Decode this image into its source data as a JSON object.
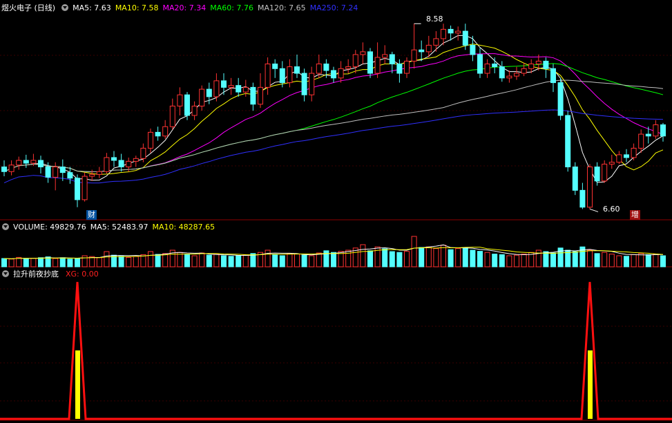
{
  "header": {
    "stock_title": "煜火电子 (日线)",
    "ma": [
      {
        "label": "MA5: 7.63",
        "color": "#ffffff"
      },
      {
        "label": "MA10: 7.58",
        "color": "#ffff00"
      },
      {
        "label": "MA20: 7.34",
        "color": "#ff00ff"
      },
      {
        "label": "MA60: 7.76",
        "color": "#00ff00"
      },
      {
        "label": "MA120: 7.65",
        "color": "#c0c0c0"
      },
      {
        "label": "MA250: 7.24",
        "color": "#3030ff"
      }
    ]
  },
  "volume_header": {
    "label": "VOLUME: 49829.76",
    "ma5": "MA5: 52483.97",
    "ma10": "MA10: 48287.65"
  },
  "indicator_header": {
    "label": "拉升前夜抄底",
    "xg": "XG: 0.00"
  },
  "annotations": {
    "high": "8.58",
    "low": "6.60",
    "cai": "财",
    "zeng": "增"
  },
  "colors": {
    "up": "#ff3232",
    "down": "#54ffff",
    "grid": "#8b0000",
    "signal": "#ff1010",
    "bar": "#ffff00"
  },
  "chart_data": {
    "type": "candlestick",
    "price_range": [
      6.5,
      8.7
    ],
    "candles": [
      [
        7.05,
        7.0,
        7.12,
        6.95
      ],
      [
        7.0,
        7.07,
        7.12,
        6.96
      ],
      [
        7.07,
        7.12,
        7.16,
        7.02
      ],
      [
        7.12,
        7.09,
        7.18,
        7.04
      ],
      [
        7.09,
        7.12,
        7.19,
        7.06
      ],
      [
        7.12,
        7.05,
        7.17,
        6.98
      ],
      [
        7.05,
        6.94,
        7.1,
        6.88
      ],
      [
        6.94,
        7.05,
        7.1,
        6.8
      ],
      [
        7.05,
        6.99,
        7.13,
        6.9
      ],
      [
        6.99,
        6.93,
        7.05,
        6.87
      ],
      [
        6.93,
        6.7,
        6.97,
        6.62
      ],
      [
        6.7,
        6.95,
        6.99,
        6.68
      ],
      [
        6.95,
        6.97,
        7.02,
        6.9
      ],
      [
        6.97,
        7.0,
        7.05,
        6.93
      ],
      [
        7.0,
        7.15,
        7.2,
        6.98
      ],
      [
        7.15,
        7.12,
        7.22,
        7.05
      ],
      [
        7.12,
        7.05,
        7.19,
        7.0
      ],
      [
        7.05,
        7.11,
        7.15,
        7.0
      ],
      [
        7.11,
        7.14,
        7.17,
        7.05
      ],
      [
        7.14,
        7.25,
        7.3,
        7.1
      ],
      [
        7.25,
        7.42,
        7.46,
        7.2
      ],
      [
        7.42,
        7.38,
        7.48,
        7.33
      ],
      [
        7.38,
        7.48,
        7.55,
        7.35
      ],
      [
        7.48,
        7.7,
        7.78,
        7.45
      ],
      [
        7.7,
        7.82,
        7.9,
        7.6
      ],
      [
        7.82,
        7.6,
        7.85,
        7.55
      ],
      [
        7.6,
        7.7,
        7.75,
        7.55
      ],
      [
        7.7,
        7.88,
        7.92,
        7.65
      ],
      [
        7.88,
        7.8,
        7.95,
        7.72
      ],
      [
        7.8,
        7.97,
        8.05,
        7.75
      ],
      [
        7.97,
        7.9,
        8.05,
        7.82
      ],
      [
        7.9,
        7.92,
        8.0,
        7.82
      ],
      [
        7.92,
        7.85,
        8.0,
        7.8
      ],
      [
        7.85,
        7.9,
        7.98,
        7.8
      ],
      [
        7.9,
        7.72,
        7.95,
        7.65
      ],
      [
        7.72,
        7.9,
        8.05,
        7.68
      ],
      [
        7.9,
        8.15,
        8.22,
        7.82
      ],
      [
        8.15,
        8.1,
        8.2,
        8.0
      ],
      [
        8.1,
        7.95,
        8.18,
        7.9
      ],
      [
        7.95,
        8.12,
        8.2,
        7.9
      ],
      [
        8.12,
        8.05,
        8.25,
        8.0
      ],
      [
        8.05,
        7.82,
        8.1,
        7.75
      ],
      [
        7.82,
        8.05,
        8.12,
        7.75
      ],
      [
        8.05,
        8.15,
        8.25,
        8.0
      ],
      [
        8.15,
        8.08,
        8.2,
        8.0
      ],
      [
        8.08,
        8.0,
        8.12,
        7.95
      ],
      [
        8.0,
        8.1,
        8.18,
        7.95
      ],
      [
        8.1,
        8.12,
        8.2,
        8.05
      ],
      [
        8.12,
        8.25,
        8.3,
        8.05
      ],
      [
        8.25,
        8.28,
        8.38,
        8.15
      ],
      [
        8.28,
        8.05,
        8.32,
        8.0
      ],
      [
        8.05,
        8.22,
        8.38,
        8.0
      ],
      [
        8.22,
        8.25,
        8.35,
        8.15
      ],
      [
        8.25,
        8.15,
        8.28,
        8.05
      ],
      [
        8.15,
        8.05,
        8.2,
        7.95
      ],
      [
        8.05,
        8.18,
        8.22,
        8.0
      ],
      [
        8.18,
        8.3,
        8.58,
        8.1
      ],
      [
        8.3,
        8.28,
        8.4,
        8.18
      ],
      [
        8.28,
        8.35,
        8.45,
        8.22
      ],
      [
        8.35,
        8.42,
        8.5,
        8.28
      ],
      [
        8.42,
        8.52,
        8.58,
        8.35
      ],
      [
        8.52,
        8.48,
        8.56,
        8.4
      ],
      [
        8.48,
        8.5,
        8.55,
        8.4
      ],
      [
        8.5,
        8.35,
        8.58,
        8.3
      ],
      [
        8.35,
        8.25,
        8.45,
        8.18
      ],
      [
        8.25,
        8.05,
        8.32,
        8.0
      ],
      [
        8.05,
        8.15,
        8.2,
        8.0
      ],
      [
        8.15,
        8.12,
        8.22,
        8.05
      ],
      [
        8.12,
        8.0,
        8.18,
        7.96
      ],
      [
        8.0,
        8.02,
        8.08,
        7.95
      ],
      [
        8.02,
        8.05,
        8.12,
        7.98
      ],
      [
        8.05,
        8.1,
        8.16,
        8.02
      ],
      [
        8.1,
        8.15,
        8.2,
        8.05
      ],
      [
        8.15,
        8.18,
        8.25,
        8.08
      ],
      [
        8.18,
        8.1,
        8.22,
        8.0
      ],
      [
        8.1,
        7.95,
        8.15,
        7.85
      ],
      [
        7.95,
        7.6,
        8.0,
        7.55
      ],
      [
        7.6,
        7.05,
        7.65,
        7.0
      ],
      [
        7.05,
        6.8,
        7.1,
        6.75
      ],
      [
        6.8,
        6.62,
        6.88,
        6.6
      ],
      [
        6.62,
        7.05,
        7.08,
        6.6
      ],
      [
        7.05,
        6.9,
        7.1,
        6.85
      ],
      [
        6.9,
        7.08,
        7.12,
        6.88
      ],
      [
        7.08,
        7.1,
        7.18,
        7.03
      ],
      [
        7.1,
        7.18,
        7.22,
        7.08
      ],
      [
        7.18,
        7.15,
        7.24,
        7.1
      ],
      [
        7.15,
        7.25,
        7.3,
        7.12
      ],
      [
        7.25,
        7.4,
        7.45,
        7.2
      ],
      [
        7.4,
        7.38,
        7.48,
        7.3
      ],
      [
        7.38,
        7.5,
        7.55,
        7.35
      ],
      [
        7.5,
        7.38,
        7.52,
        7.32
      ]
    ],
    "volume_range": [
      0,
      130000
    ],
    "volumes": [
      [
        30000,
        0
      ],
      [
        28000,
        1
      ],
      [
        34000,
        1
      ],
      [
        30000,
        0
      ],
      [
        31000,
        1
      ],
      [
        33000,
        0
      ],
      [
        36000,
        0
      ],
      [
        30000,
        1
      ],
      [
        33000,
        0
      ],
      [
        28000,
        0
      ],
      [
        30000,
        0
      ],
      [
        40000,
        1
      ],
      [
        37000,
        1
      ],
      [
        33000,
        1
      ],
      [
        55000,
        1
      ],
      [
        42000,
        0
      ],
      [
        38000,
        0
      ],
      [
        34000,
        1
      ],
      [
        37000,
        1
      ],
      [
        44000,
        1
      ],
      [
        55000,
        1
      ],
      [
        45000,
        0
      ],
      [
        48000,
        1
      ],
      [
        60000,
        1
      ],
      [
        52000,
        1
      ],
      [
        45000,
        0
      ],
      [
        40000,
        1
      ],
      [
        50000,
        1
      ],
      [
        42000,
        0
      ],
      [
        45000,
        1
      ],
      [
        40000,
        0
      ],
      [
        38000,
        0
      ],
      [
        41000,
        0
      ],
      [
        43000,
        1
      ],
      [
        48000,
        0
      ],
      [
        52000,
        1
      ],
      [
        60000,
        1
      ],
      [
        45000,
        0
      ],
      [
        40000,
        0
      ],
      [
        48000,
        1
      ],
      [
        46000,
        1
      ],
      [
        42000,
        0
      ],
      [
        40000,
        1
      ],
      [
        50000,
        1
      ],
      [
        58000,
        0
      ],
      [
        52000,
        0
      ],
      [
        56000,
        1
      ],
      [
        60000,
        1
      ],
      [
        68000,
        1
      ],
      [
        80000,
        1
      ],
      [
        58000,
        0
      ],
      [
        72000,
        1
      ],
      [
        65000,
        0
      ],
      [
        55000,
        0
      ],
      [
        52000,
        0
      ],
      [
        56000,
        1
      ],
      [
        110000,
        1
      ],
      [
        70000,
        0
      ],
      [
        72000,
        1
      ],
      [
        66000,
        1
      ],
      [
        78000,
        1
      ],
      [
        62000,
        0
      ],
      [
        66000,
        1
      ],
      [
        70000,
        0
      ],
      [
        60000,
        0
      ],
      [
        56000,
        0
      ],
      [
        52000,
        1
      ],
      [
        46000,
        0
      ],
      [
        44000,
        0
      ],
      [
        40000,
        1
      ],
      [
        42000,
        1
      ],
      [
        46000,
        1
      ],
      [
        52000,
        1
      ],
      [
        60000,
        1
      ],
      [
        55000,
        0
      ],
      [
        50000,
        0
      ],
      [
        68000,
        0
      ],
      [
        60000,
        0
      ],
      [
        55000,
        0
      ],
      [
        72000,
        0
      ],
      [
        60000,
        1
      ],
      [
        48000,
        0
      ],
      [
        52000,
        1
      ],
      [
        46000,
        1
      ],
      [
        40000,
        1
      ],
      [
        38000,
        0
      ],
      [
        44000,
        1
      ],
      [
        48000,
        1
      ],
      [
        44000,
        0
      ],
      [
        46000,
        1
      ],
      [
        40000,
        0
      ]
    ],
    "signals": [
      {
        "index": 10,
        "value": 1
      },
      {
        "index": 80,
        "value": 1
      }
    ]
  }
}
